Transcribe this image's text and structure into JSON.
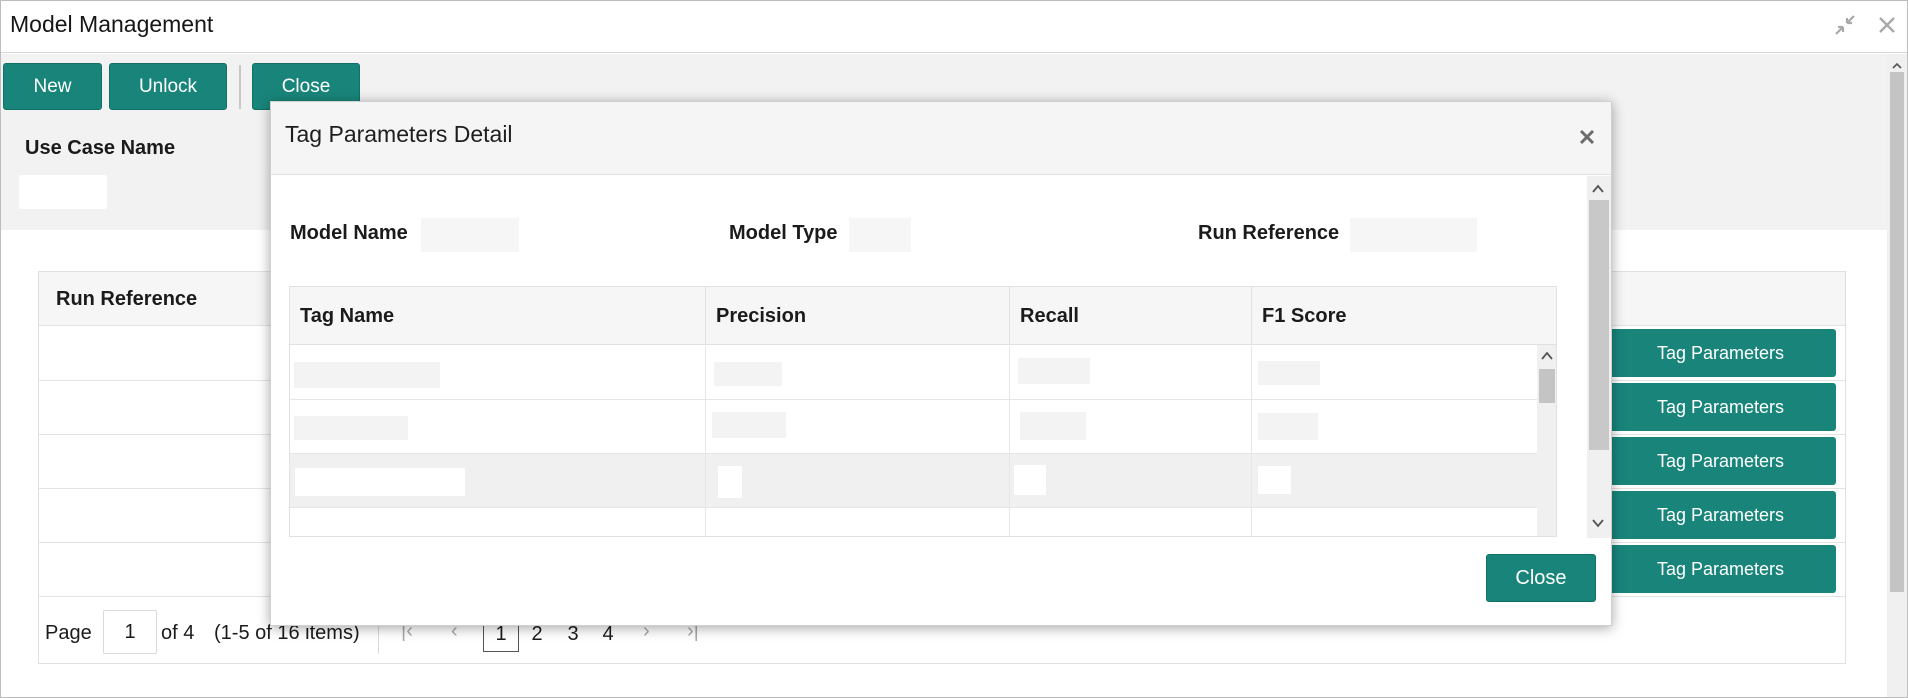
{
  "window": {
    "title": "Model Management"
  },
  "toolbar": {
    "new_label": "New",
    "unlock_label": "Unlock",
    "close_label": "Close"
  },
  "use_case": {
    "label": "Use Case Name",
    "value": ""
  },
  "main_table": {
    "header": "Run Reference",
    "row_buttons": [
      "Tag Parameters",
      "Tag Parameters",
      "Tag Parameters",
      "Tag Parameters",
      "Tag Parameters"
    ]
  },
  "pagination": {
    "page_label": "Page",
    "current_page": "1",
    "of_label": "of 4",
    "items_label": "(1-5 of 16 items)",
    "pages": [
      "1",
      "2",
      "3",
      "4"
    ]
  },
  "modal": {
    "title": "Tag Parameters Detail",
    "model_name_label": "Model Name",
    "model_type_label": "Model Type",
    "run_reference_label": "Run Reference",
    "columns": [
      "Tag Name",
      "Precision",
      "Recall",
      "F1 Score"
    ],
    "close_label": "Close"
  },
  "colors": {
    "accent": "#19857a",
    "header_bg": "#f6f6f6",
    "toolbar_bg": "#f2f2f2"
  }
}
